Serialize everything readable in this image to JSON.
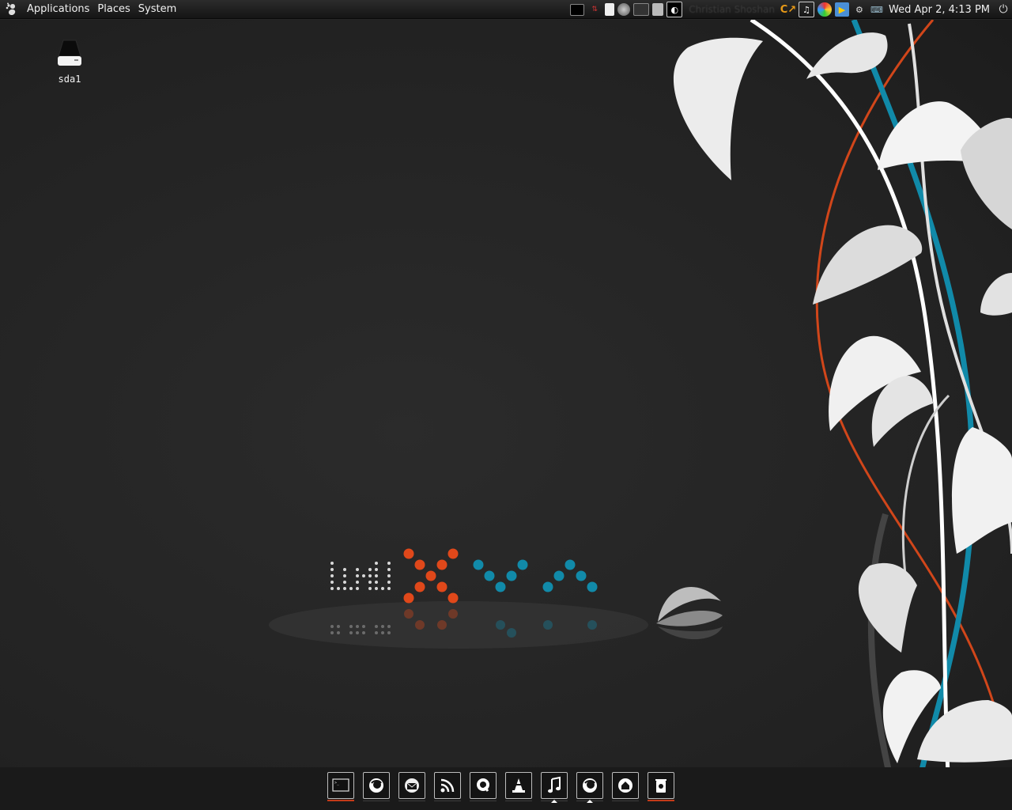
{
  "top_panel": {
    "menus": [
      "Applications",
      "Places",
      "System"
    ],
    "logo_icon": "gnome-foot-icon",
    "tray_icons": [
      "terminal-icon",
      "network-activity-icon",
      "clipboard-icon",
      "globe-icon",
      "system-monitor-icon",
      "files-icon",
      "firefox-icon"
    ],
    "user_name": "Christian Shoshan",
    "tray_icons_right": [
      "update-icon",
      "music-note-icon",
      "colorful-swirl-icon",
      "media-player-icon",
      "camera-icon",
      "network-icon"
    ],
    "clock": "Wed Apr  2,  4:13 PM",
    "power_icon": "power-icon"
  },
  "desktop": {
    "icons": [
      {
        "label": "sda1",
        "icon": "drive-icon"
      }
    ]
  },
  "wallpaper": {
    "logo_text": "linux",
    "colors": {
      "orange": "#e0481a",
      "blue": "#118aa9",
      "gray": "#cfcfcf",
      "white": "#ffffff"
    }
  },
  "dock": {
    "items": [
      {
        "name": "terminal",
        "icon": "terminal-icon"
      },
      {
        "name": "firefox",
        "icon": "firefox-icon"
      },
      {
        "name": "mail",
        "icon": "mail-icon"
      },
      {
        "name": "rss",
        "icon": "rss-icon"
      },
      {
        "name": "quicktime",
        "icon": "q-icon"
      },
      {
        "name": "vlc",
        "icon": "cone-icon"
      },
      {
        "name": "music",
        "icon": "music-note-icon"
      },
      {
        "name": "firefox-2",
        "icon": "firefox-icon"
      },
      {
        "name": "home",
        "icon": "home-icon"
      },
      {
        "name": "trash",
        "icon": "trash-icon"
      }
    ]
  }
}
